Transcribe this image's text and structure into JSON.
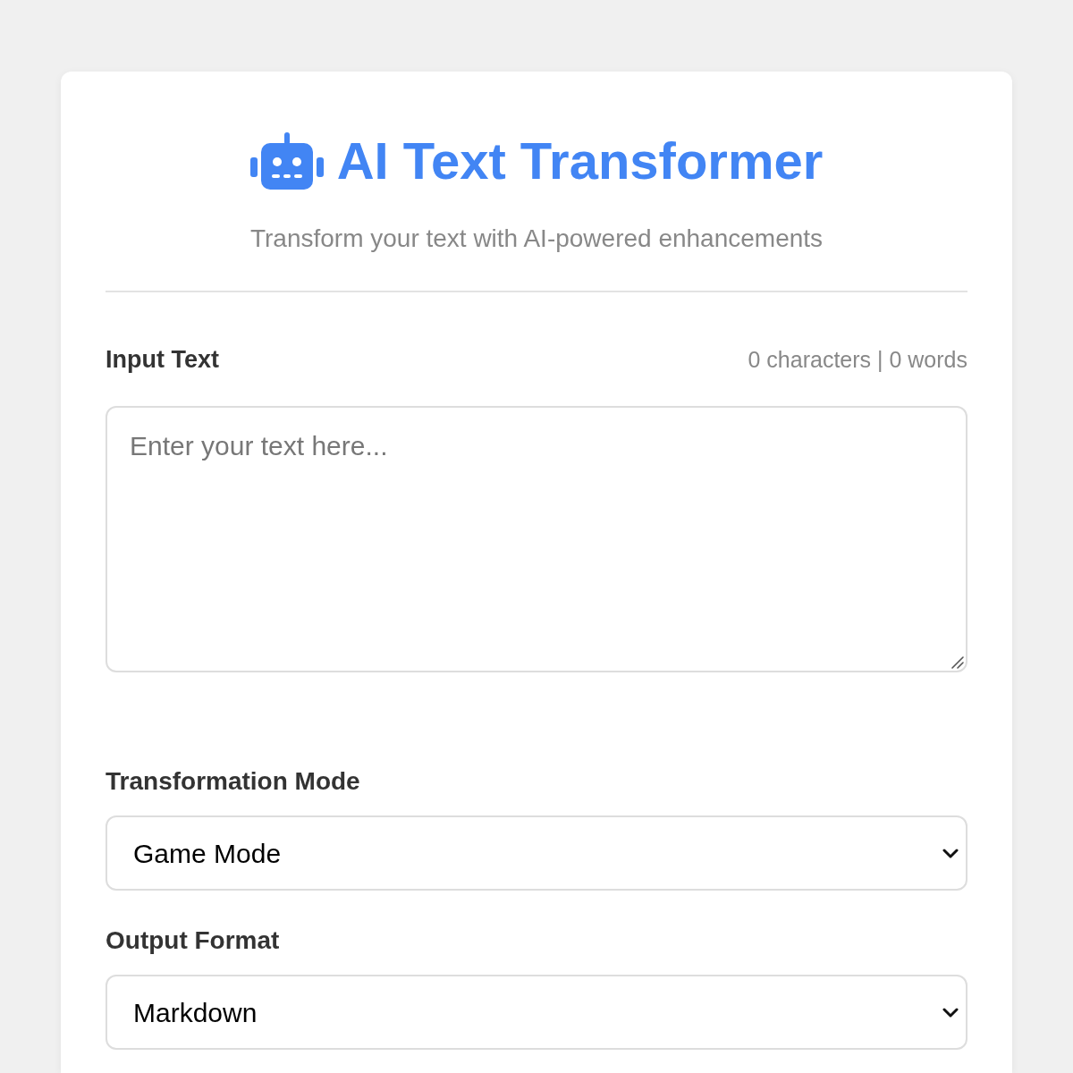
{
  "header": {
    "title": "AI Text Transformer",
    "subtitle": "Transform your text with AI-powered enhancements"
  },
  "input": {
    "label": "Input Text",
    "counter": "0 characters | 0 words",
    "placeholder": "Enter your text here..."
  },
  "fields": [
    {
      "label": "Transformation Mode",
      "value": "Game Mode"
    },
    {
      "label": "Output Format",
      "value": "Markdown"
    }
  ]
}
